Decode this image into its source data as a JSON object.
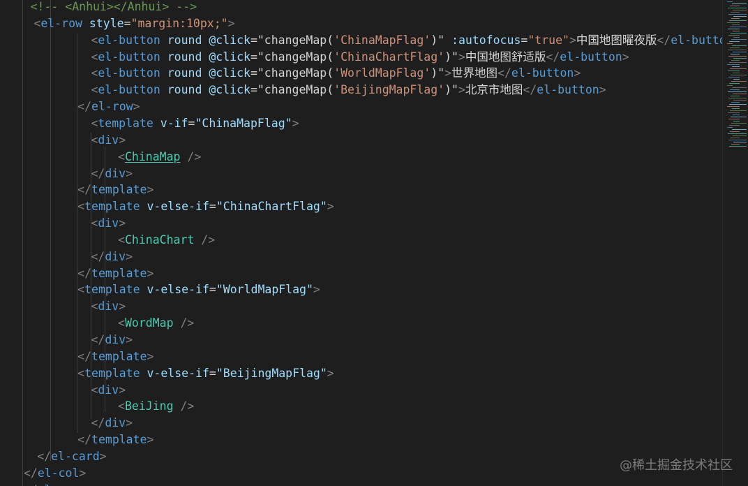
{
  "editor": {
    "lines": [
      {
        "indent": 2,
        "tokens": [
          {
            "t": "<!-- <Anhui></Anhui> -->",
            "c": "com"
          }
        ]
      },
      {
        "indent": 2.25,
        "tokens": [
          {
            "t": "<",
            "c": "pun"
          },
          {
            "t": "el-row",
            "c": "tag"
          },
          {
            "t": " ",
            "c": "text"
          },
          {
            "t": "style",
            "c": "attr"
          },
          {
            "t": "=",
            "c": "text"
          },
          {
            "t": "\"margin:10px;\"",
            "c": "str"
          },
          {
            "t": ">",
            "c": "pun"
          }
        ]
      },
      {
        "indent": 6.5,
        "tokens": [
          {
            "t": "<",
            "c": "pun"
          },
          {
            "t": "el-button",
            "c": "tag"
          },
          {
            "t": " ",
            "c": "text"
          },
          {
            "t": "round",
            "c": "attr"
          },
          {
            "t": " ",
            "c": "text"
          },
          {
            "t": "@click",
            "c": "attr"
          },
          {
            "t": "=",
            "c": "text"
          },
          {
            "t": "\"changeMap(",
            "c": "text"
          },
          {
            "t": "'ChinaMapFlag'",
            "c": "str"
          },
          {
            "t": ")\"",
            "c": "text"
          },
          {
            "t": " ",
            "c": "text"
          },
          {
            "t": ":autofocus",
            "c": "attr"
          },
          {
            "t": "=",
            "c": "text"
          },
          {
            "t": "\"true\"",
            "c": "str"
          },
          {
            "t": ">",
            "c": "pun"
          },
          {
            "t": "中国地图曜夜版",
            "c": "text"
          },
          {
            "t": "</",
            "c": "pun"
          },
          {
            "t": "el-button",
            "c": "tag"
          }
        ]
      },
      {
        "indent": 6.5,
        "tokens": [
          {
            "t": "<",
            "c": "pun"
          },
          {
            "t": "el-button",
            "c": "tag"
          },
          {
            "t": " ",
            "c": "text"
          },
          {
            "t": "round",
            "c": "attr"
          },
          {
            "t": " ",
            "c": "text"
          },
          {
            "t": "@click",
            "c": "attr"
          },
          {
            "t": "=",
            "c": "text"
          },
          {
            "t": "\"changeMap(",
            "c": "text"
          },
          {
            "t": "'ChinaChartFlag'",
            "c": "str"
          },
          {
            "t": ")\"",
            "c": "text"
          },
          {
            "t": ">",
            "c": "pun"
          },
          {
            "t": "中国地图舒适版",
            "c": "text"
          },
          {
            "t": "</",
            "c": "pun"
          },
          {
            "t": "el-button",
            "c": "tag"
          },
          {
            "t": ">",
            "c": "pun"
          }
        ]
      },
      {
        "indent": 6.5,
        "tokens": [
          {
            "t": "<",
            "c": "pun"
          },
          {
            "t": "el-button",
            "c": "tag"
          },
          {
            "t": " ",
            "c": "text"
          },
          {
            "t": "round",
            "c": "attr"
          },
          {
            "t": " ",
            "c": "text"
          },
          {
            "t": "@click",
            "c": "attr"
          },
          {
            "t": "=",
            "c": "text"
          },
          {
            "t": "\"changeMap(",
            "c": "text"
          },
          {
            "t": "'WorldMapFlag'",
            "c": "str"
          },
          {
            "t": ")\"",
            "c": "text"
          },
          {
            "t": ">",
            "c": "pun"
          },
          {
            "t": "世界地图",
            "c": "text"
          },
          {
            "t": "</",
            "c": "pun"
          },
          {
            "t": "el-button",
            "c": "tag"
          },
          {
            "t": ">",
            "c": "pun"
          }
        ]
      },
      {
        "indent": 6.5,
        "tokens": [
          {
            "t": "<",
            "c": "pun"
          },
          {
            "t": "el-button",
            "c": "tag"
          },
          {
            "t": " ",
            "c": "text"
          },
          {
            "t": "round",
            "c": "attr"
          },
          {
            "t": " ",
            "c": "text"
          },
          {
            "t": "@click",
            "c": "attr"
          },
          {
            "t": "=",
            "c": "text"
          },
          {
            "t": "\"changeMap(",
            "c": "text"
          },
          {
            "t": "'BeijingMapFlag'",
            "c": "str"
          },
          {
            "t": ")\"",
            "c": "text"
          },
          {
            "t": ">",
            "c": "pun"
          },
          {
            "t": "北京市地图",
            "c": "text"
          },
          {
            "t": "</",
            "c": "pun"
          },
          {
            "t": "el-button",
            "c": "tag"
          },
          {
            "t": ">",
            "c": "pun"
          }
        ]
      },
      {
        "indent": 5.5,
        "tokens": [
          {
            "t": "</",
            "c": "pun"
          },
          {
            "t": "el-row",
            "c": "tag"
          },
          {
            "t": ">",
            "c": "pun"
          }
        ]
      },
      {
        "indent": 6.5,
        "tokens": [
          {
            "t": "<",
            "c": "pun"
          },
          {
            "t": "template",
            "c": "tag"
          },
          {
            "t": " ",
            "c": "text"
          },
          {
            "t": "v-if",
            "c": "attr"
          },
          {
            "t": "=",
            "c": "text"
          },
          {
            "t": "\"ChinaMapFlag\"",
            "c": "attr"
          },
          {
            "t": ">",
            "c": "pun"
          }
        ]
      },
      {
        "indent": 6.5,
        "tokens": [
          {
            "t": "<",
            "c": "pun"
          },
          {
            "t": "div",
            "c": "tag"
          },
          {
            "t": ">",
            "c": "pun"
          }
        ]
      },
      {
        "indent": 8.5,
        "tokens": [
          {
            "t": "<",
            "c": "pun"
          },
          {
            "t": "ChinaMap",
            "c": "comp",
            "u": true
          },
          {
            "t": " ",
            "c": "text"
          },
          {
            "t": "/>",
            "c": "pun"
          }
        ]
      },
      {
        "indent": 6.5,
        "tokens": [
          {
            "t": "</",
            "c": "pun"
          },
          {
            "t": "div",
            "c": "tag"
          },
          {
            "t": ">",
            "c": "pun"
          }
        ]
      },
      {
        "indent": 5.5,
        "tokens": [
          {
            "t": "</",
            "c": "pun"
          },
          {
            "t": "template",
            "c": "tag"
          },
          {
            "t": ">",
            "c": "pun"
          }
        ]
      },
      {
        "indent": 5.5,
        "tokens": [
          {
            "t": "<",
            "c": "pun"
          },
          {
            "t": "template",
            "c": "tag"
          },
          {
            "t": " ",
            "c": "text"
          },
          {
            "t": "v-else-if",
            "c": "attr"
          },
          {
            "t": "=",
            "c": "text"
          },
          {
            "t": "\"ChinaChartFlag\"",
            "c": "attr"
          },
          {
            "t": ">",
            "c": "pun"
          }
        ]
      },
      {
        "indent": 6.5,
        "tokens": [
          {
            "t": "<",
            "c": "pun"
          },
          {
            "t": "div",
            "c": "tag"
          },
          {
            "t": ">",
            "c": "pun"
          }
        ]
      },
      {
        "indent": 8.5,
        "tokens": [
          {
            "t": "<",
            "c": "pun"
          },
          {
            "t": "ChinaChart",
            "c": "comp"
          },
          {
            "t": " ",
            "c": "text"
          },
          {
            "t": "/>",
            "c": "pun"
          }
        ]
      },
      {
        "indent": 6.5,
        "tokens": [
          {
            "t": "</",
            "c": "pun"
          },
          {
            "t": "div",
            "c": "tag"
          },
          {
            "t": ">",
            "c": "pun"
          }
        ]
      },
      {
        "indent": 5.5,
        "tokens": [
          {
            "t": "</",
            "c": "pun"
          },
          {
            "t": "template",
            "c": "tag"
          },
          {
            "t": ">",
            "c": "pun"
          }
        ]
      },
      {
        "indent": 5.5,
        "tokens": [
          {
            "t": "<",
            "c": "pun"
          },
          {
            "t": "template",
            "c": "tag"
          },
          {
            "t": " ",
            "c": "text"
          },
          {
            "t": "v-else-if",
            "c": "attr"
          },
          {
            "t": "=",
            "c": "text"
          },
          {
            "t": "\"WorldMapFlag\"",
            "c": "attr"
          },
          {
            "t": ">",
            "c": "pun"
          }
        ]
      },
      {
        "indent": 6.5,
        "tokens": [
          {
            "t": "<",
            "c": "pun"
          },
          {
            "t": "div",
            "c": "tag"
          },
          {
            "t": ">",
            "c": "pun"
          }
        ]
      },
      {
        "indent": 8.5,
        "tokens": [
          {
            "t": "<",
            "c": "pun"
          },
          {
            "t": "WordMap",
            "c": "comp"
          },
          {
            "t": " ",
            "c": "text"
          },
          {
            "t": "/>",
            "c": "pun"
          }
        ]
      },
      {
        "indent": 6.5,
        "tokens": [
          {
            "t": "</",
            "c": "pun"
          },
          {
            "t": "div",
            "c": "tag"
          },
          {
            "t": ">",
            "c": "pun"
          }
        ]
      },
      {
        "indent": 5.5,
        "tokens": [
          {
            "t": "</",
            "c": "pun"
          },
          {
            "t": "template",
            "c": "tag"
          },
          {
            "t": ">",
            "c": "pun"
          }
        ]
      },
      {
        "indent": 5.5,
        "tokens": [
          {
            "t": "<",
            "c": "pun"
          },
          {
            "t": "template",
            "c": "tag"
          },
          {
            "t": " ",
            "c": "text"
          },
          {
            "t": "v-else-if",
            "c": "attr"
          },
          {
            "t": "=",
            "c": "text"
          },
          {
            "t": "\"BeijingMapFlag\"",
            "c": "attr"
          },
          {
            "t": ">",
            "c": "pun"
          }
        ]
      },
      {
        "indent": 6.5,
        "tokens": [
          {
            "t": "<",
            "c": "pun"
          },
          {
            "t": "div",
            "c": "tag"
          },
          {
            "t": ">",
            "c": "pun"
          }
        ]
      },
      {
        "indent": 8.5,
        "tokens": [
          {
            "t": "<",
            "c": "pun"
          },
          {
            "t": "BeiJing",
            "c": "comp"
          },
          {
            "t": " ",
            "c": "text"
          },
          {
            "t": "/>",
            "c": "pun"
          }
        ]
      },
      {
        "indent": 6.5,
        "tokens": [
          {
            "t": "</",
            "c": "pun"
          },
          {
            "t": "div",
            "c": "tag"
          },
          {
            "t": ">",
            "c": "pun"
          }
        ]
      },
      {
        "indent": 5.5,
        "tokens": [
          {
            "t": "</",
            "c": "pun"
          },
          {
            "t": "template",
            "c": "tag"
          },
          {
            "t": ">",
            "c": "pun"
          }
        ]
      },
      {
        "indent": 2.5,
        "tokens": [
          {
            "t": "</",
            "c": "pun"
          },
          {
            "t": "el-card",
            "c": "tag"
          },
          {
            "t": ">",
            "c": "pun"
          }
        ]
      },
      {
        "indent": 1.5,
        "tokens": [
          {
            "t": "</",
            "c": "pun"
          },
          {
            "t": "el-col",
            "c": "tag"
          },
          {
            "t": ">",
            "c": "pun"
          }
        ]
      },
      {
        "indent": 1.5,
        "tokens": [
          {
            "t": "</",
            "c": "pun"
          },
          {
            "t": "el-row",
            "c": "tag"
          },
          {
            "t": ">",
            "c": "pun"
          }
        ]
      }
    ],
    "colors": {
      "background": "#1e1e1e",
      "tag": "#569cd6",
      "component": "#4ec9b0",
      "attribute": "#9cdcfe",
      "string": "#ce9178",
      "comment": "#6a9955",
      "punctuation": "#808080"
    }
  },
  "watermark": {
    "text": "@稀土掘金技术社区"
  }
}
